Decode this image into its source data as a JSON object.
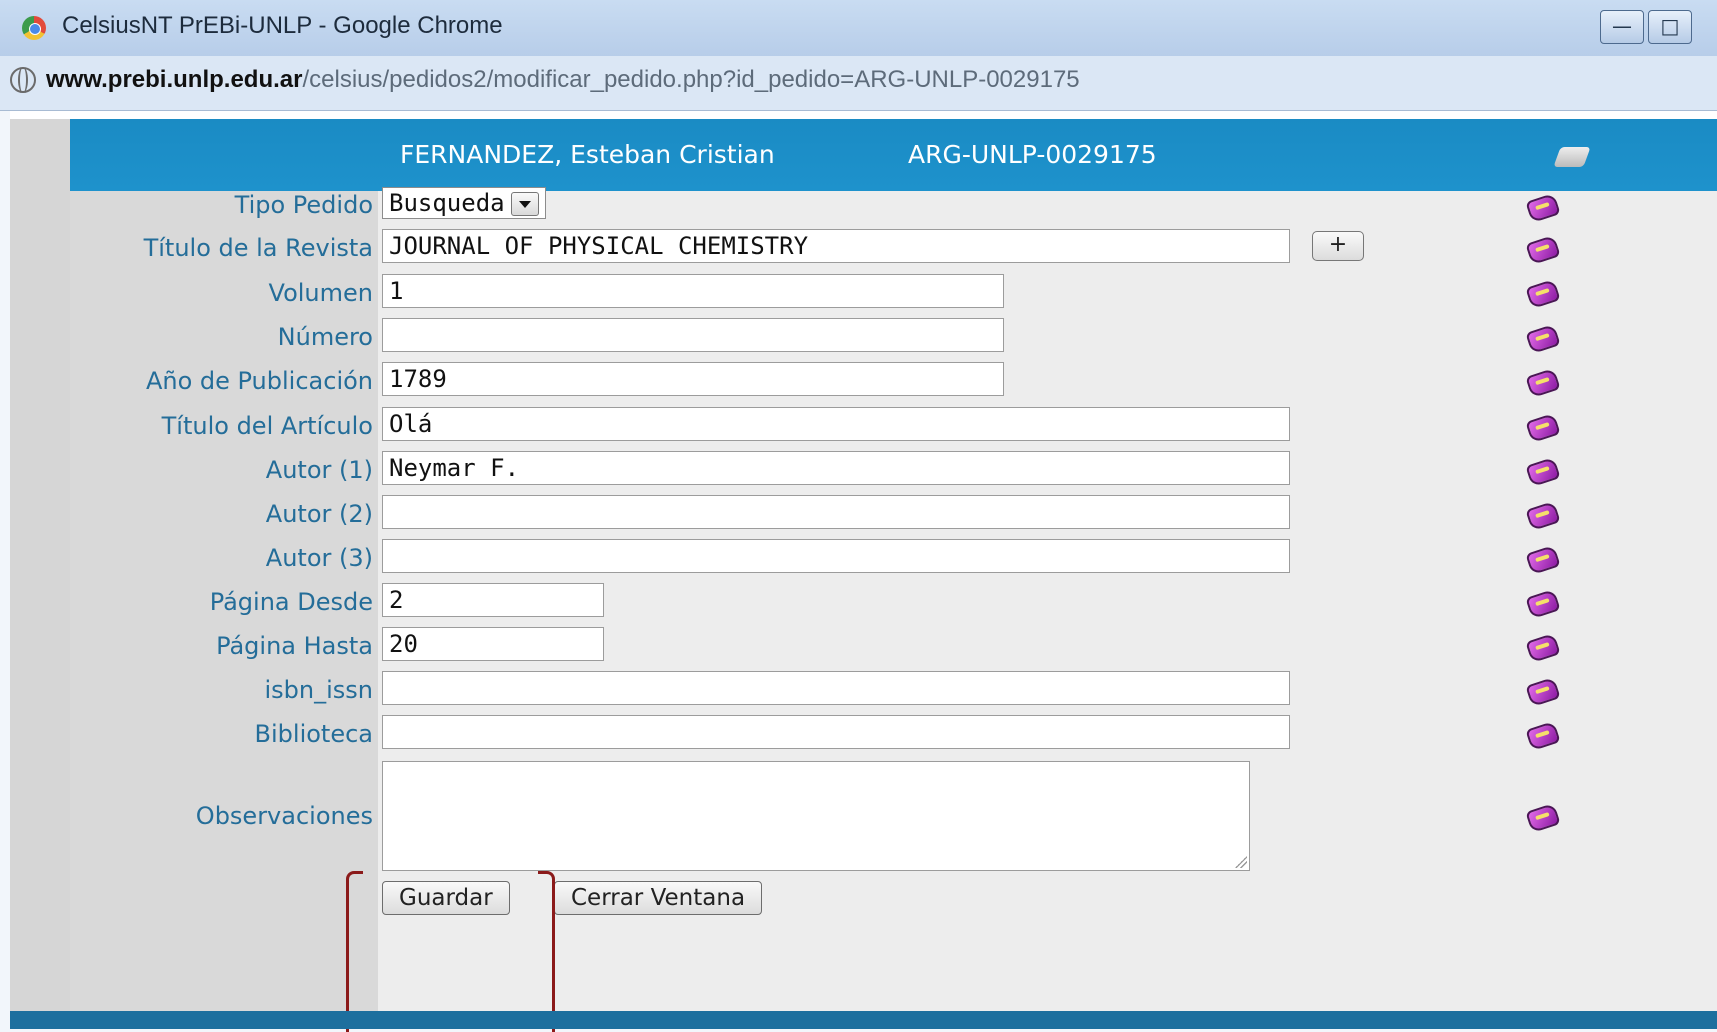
{
  "window": {
    "title": "CelsiusNT PrEBi-UNLP - Google Chrome",
    "minimize_icon": "minimize-icon",
    "maximize_icon": "maximize-icon"
  },
  "address_bar": {
    "host": "www.prebi.unlp.edu.ar",
    "path": "/celsius/pedidos2/modificar_pedido.php?id_pedido=ARG-UNLP-0029175"
  },
  "header": {
    "user_name": "FERNANDEZ, Esteban Cristian",
    "order_id": "ARG-UNLP-0029175"
  },
  "form": {
    "tipo_pedido": {
      "label": "Tipo Pedido",
      "value": "Busqueda"
    },
    "titulo_revista": {
      "label": "Título de la Revista",
      "value": "JOURNAL OF PHYSICAL CHEMISTRY",
      "add_button": "+"
    },
    "volumen": {
      "label": "Volumen",
      "value": "1"
    },
    "numero": {
      "label": "Número",
      "value": ""
    },
    "anio": {
      "label": "Año de Publicación",
      "value": "1789"
    },
    "titulo_articulo": {
      "label": "Título del Artículo",
      "value": "Olá"
    },
    "autor1": {
      "label": "Autor (1)",
      "value": "Neymar F."
    },
    "autor2": {
      "label": "Autor (2)",
      "value": ""
    },
    "autor3": {
      "label": "Autor (3)",
      "value": ""
    },
    "pagina_desde": {
      "label": "Página Desde",
      "value": "2"
    },
    "pagina_hasta": {
      "label": "Página Hasta",
      "value": "20"
    },
    "isbn_issn": {
      "label": "isbn_issn",
      "value": ""
    },
    "biblioteca": {
      "label": "Biblioteca",
      "value": ""
    },
    "observaciones": {
      "label": "Observaciones",
      "value": ""
    }
  },
  "buttons": {
    "guardar": "Guardar",
    "cerrar": "Cerrar Ventana"
  },
  "colors": {
    "header_bg": "#1a8bc4",
    "label_text": "#246d99",
    "annotation": "#8b1a1a"
  }
}
